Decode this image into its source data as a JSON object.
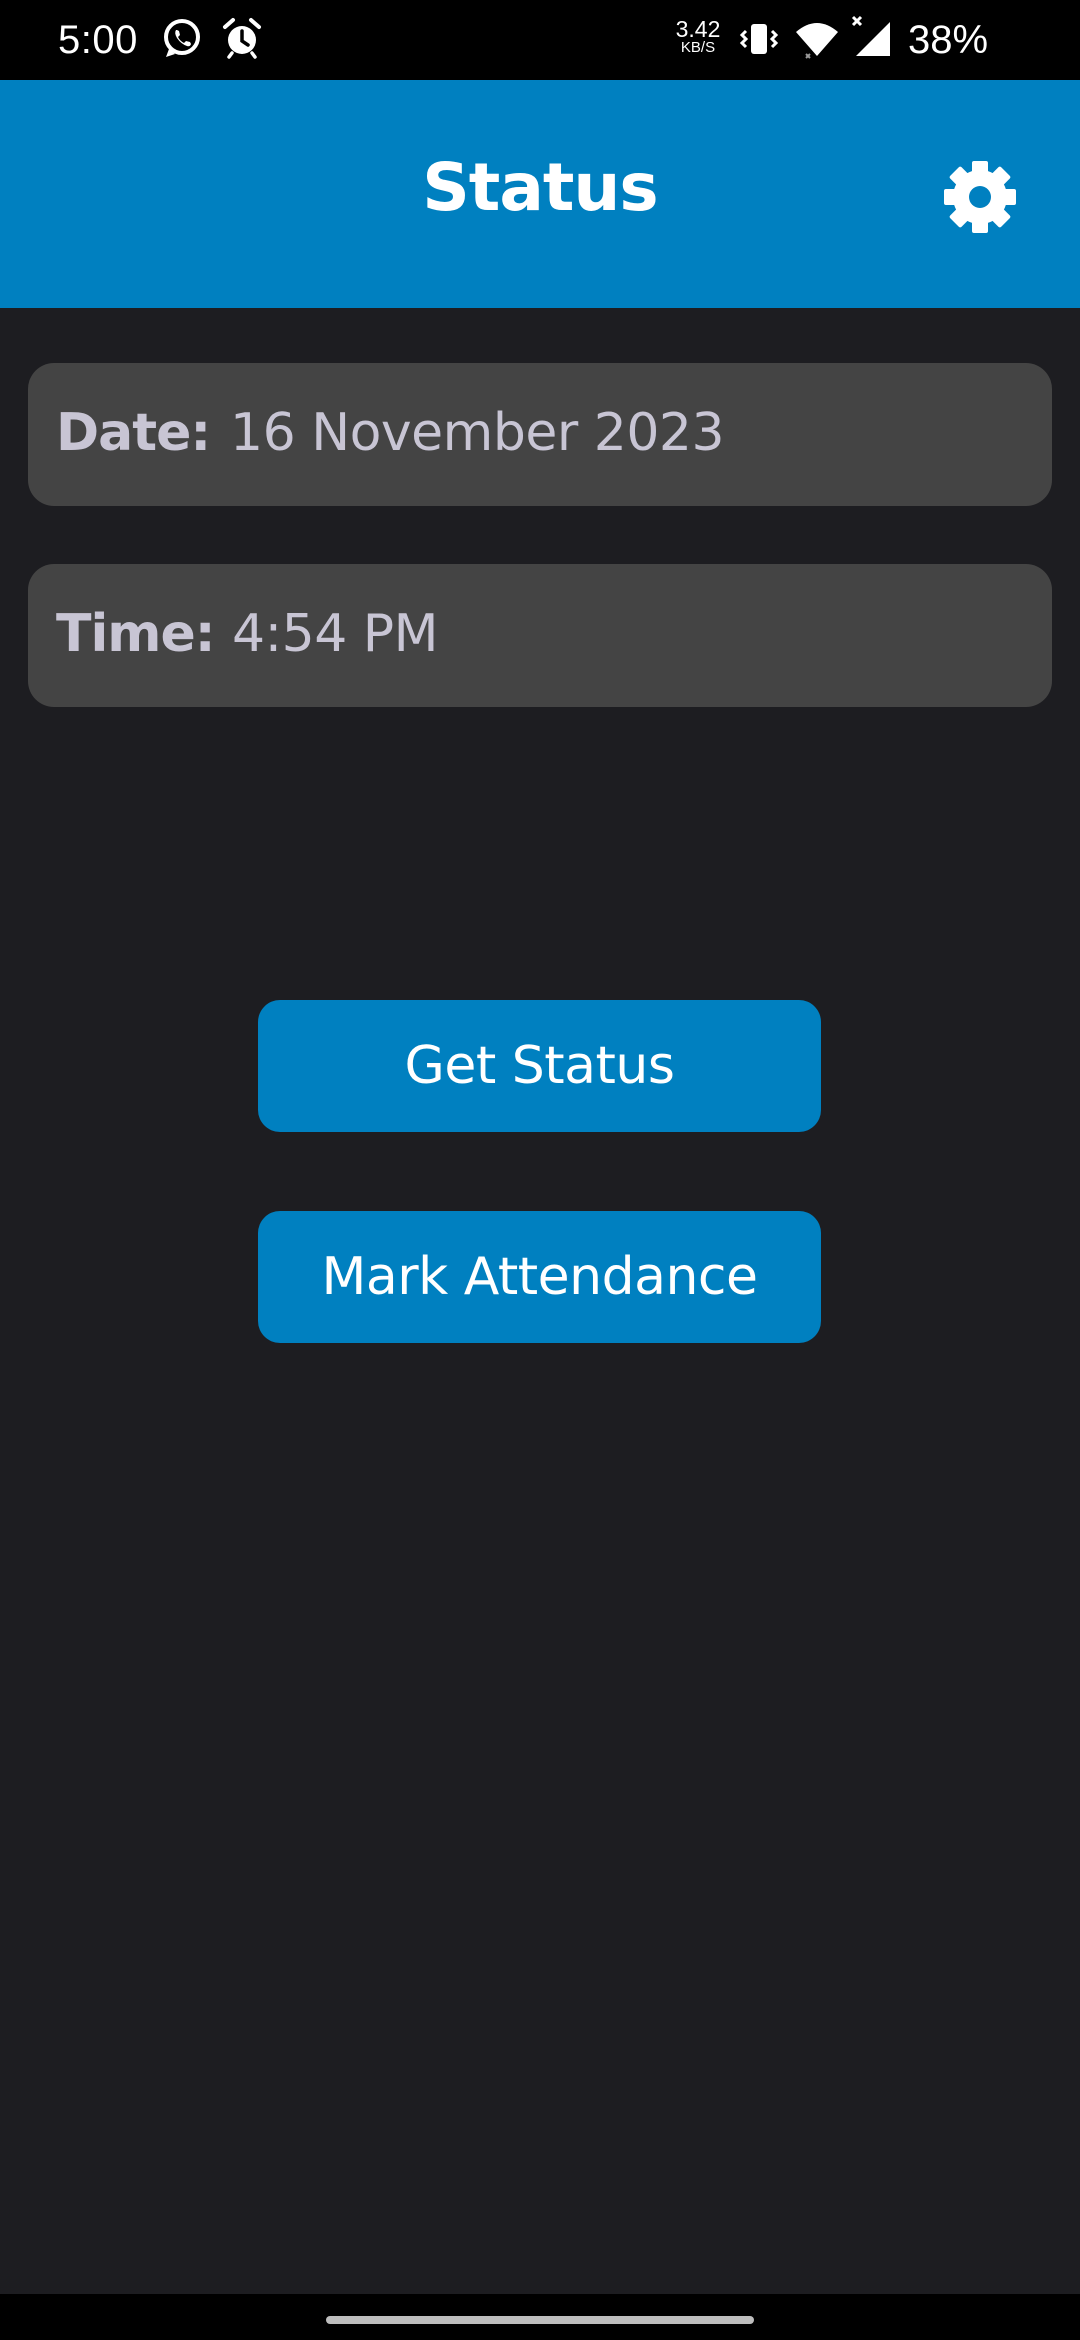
{
  "status_bar": {
    "time": "5:00",
    "net_speed_value": "3.42",
    "net_speed_unit": "KB/S",
    "battery": "38%",
    "icons": [
      "whatsapp-icon",
      "alarm-icon",
      "vibrate-icon",
      "wifi-icon",
      "signal-icon"
    ]
  },
  "app_bar": {
    "title": "Status",
    "settings_icon": "gear-icon"
  },
  "date_card": {
    "label": "Date:",
    "value": "16 November 2023"
  },
  "time_card": {
    "label": "Time:",
    "value": "4:54 PM"
  },
  "buttons": {
    "get_status": "Get Status",
    "mark_attendance": "Mark Attendance"
  },
  "colors": {
    "primary": "#0080c0",
    "background": "#1d1d21",
    "card": "#444444",
    "card_text": "#c8c5d4"
  }
}
